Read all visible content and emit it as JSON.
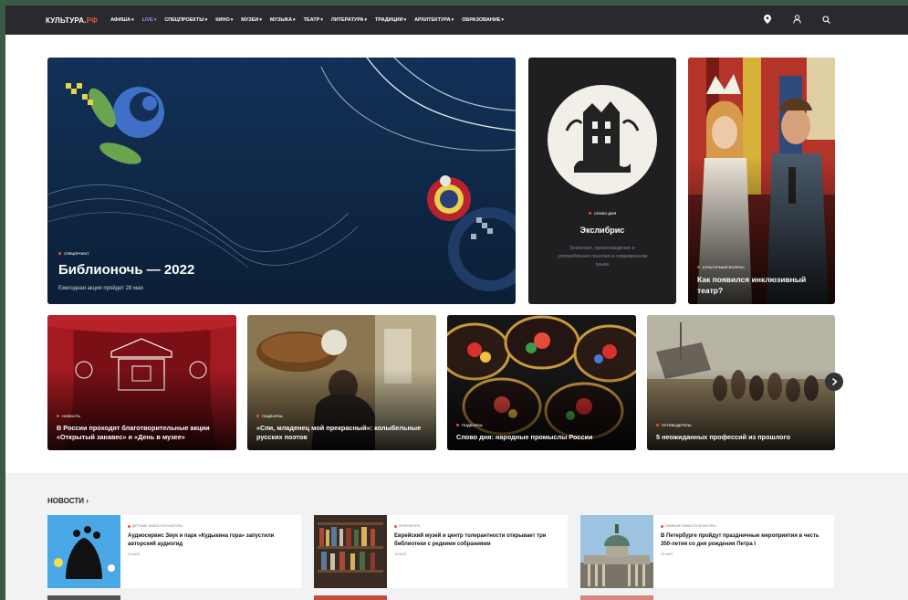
{
  "nav": {
    "logo_main": "КУЛЬТУРА.",
    "logo_suffix": "РФ",
    "items": [
      {
        "label": "АФИША"
      },
      {
        "label": "LIVE"
      },
      {
        "label": "СПЕЦПРОЕКТЫ"
      },
      {
        "label": "КИНО"
      },
      {
        "label": "МУЗЕИ"
      },
      {
        "label": "МУЗЫКА"
      },
      {
        "label": "ТЕАТР"
      },
      {
        "label": "ЛИТЕРАТУРА"
      },
      {
        "label": "ТРАДИЦИИ"
      },
      {
        "label": "АРХИТЕКТУРА"
      },
      {
        "label": "ОБРАЗОВАНИЕ"
      }
    ],
    "icons": [
      "location-icon",
      "user-icon",
      "search-icon"
    ]
  },
  "hero": {
    "tag": "Спецпроект",
    "title": "Библионочь — 2022",
    "subtitle": "Ежегодная акция пройдет 28 мая"
  },
  "word_card": {
    "tag": "Слово дня",
    "title": "Экслибрис",
    "description": "Значение, происхождение и употребление понятия в современном языке"
  },
  "theatre_card": {
    "tag": "Культурный вопрос",
    "title": "Как появился инклюзивный театр?"
  },
  "row_cards": [
    {
      "tag": "Новость",
      "title": "В России проходят благотворительные акции «Открытый занавес» и «День в музее»"
    },
    {
      "tag": "Подборка",
      "title": "«Спи, младенец мой прекрасный»: колыбельные русских поэтов"
    },
    {
      "tag": "Подборка",
      "title": "Слово дня: народные промыслы России"
    },
    {
      "tag": "Путеводитель",
      "title": "5 неожиданных профессий из прошлого"
    }
  ],
  "news": {
    "heading": "НОВОСТИ",
    "items": [
      {
        "tag": "Детские новости культуры",
        "title": "Аудиосервис Звук и парк «Кудыкина гора» запустили авторский аудиогид",
        "date": "24 мая"
      },
      {
        "tag": "Литература",
        "title": "Еврейский музей и центр толерантности открывает три библиотеки с редкими собраниями",
        "date": "25 мая"
      },
      {
        "tag": "Главные новости культуры",
        "title": "В Петербурге пройдут праздничные мероприятия в честь 350-летия со дня рождения Петра I",
        "date": "25 мая"
      }
    ]
  },
  "colors": {
    "nav_bg": "#2a2a2e",
    "accent": "#e5532b",
    "live": "#9b8cff",
    "hero_bg": "#0f2a4a",
    "news_bg": "#f1f2f4"
  }
}
